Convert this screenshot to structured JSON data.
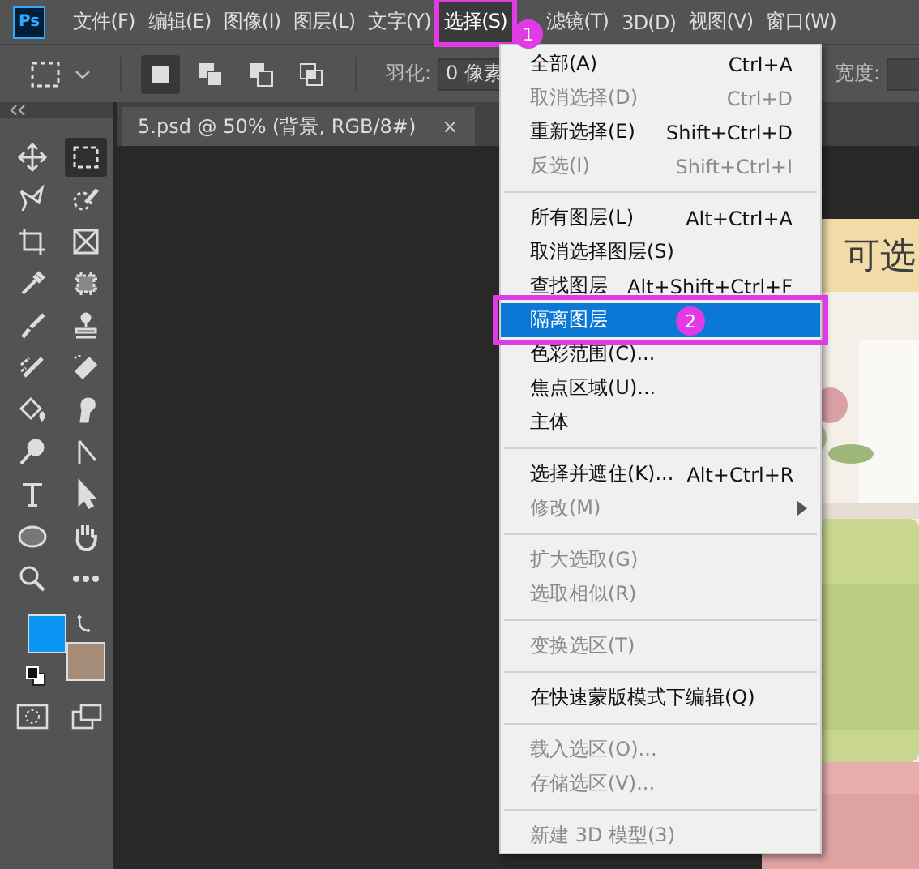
{
  "app": {
    "logo": "Ps"
  },
  "menubar": [
    {
      "label": "文件(F)",
      "selected": false
    },
    {
      "label": "编辑(E)",
      "selected": false
    },
    {
      "label": "图像(I)",
      "selected": false
    },
    {
      "label": "图层(L)",
      "selected": false
    },
    {
      "label": "文字(Y)",
      "selected": false
    },
    {
      "label": "选择(S)",
      "selected": true,
      "callout": "1"
    },
    {
      "label": "滤镜(T)",
      "selected": false
    },
    {
      "label": "3D(D)",
      "selected": false
    },
    {
      "label": "视图(V)",
      "selected": false
    },
    {
      "label": "窗口(W)",
      "selected": false
    }
  ],
  "options_bar": {
    "modes": [
      {
        "kind": "new",
        "selected": true
      },
      {
        "kind": "add",
        "selected": false
      },
      {
        "kind": "subtract",
        "selected": false
      },
      {
        "kind": "intersect",
        "selected": false
      }
    ],
    "feather_label": "羽化:",
    "feather_value": "0 像素",
    "width_label": "宽度:"
  },
  "document_tab": {
    "title": "5.psd @ 50% (背景, RGB/8#)",
    "close": "×"
  },
  "tools": [
    {
      "kind": "move",
      "selected": false
    },
    {
      "kind": "marquee",
      "selected": true
    },
    {
      "kind": "lasso",
      "selected": false
    },
    {
      "kind": "quick-select",
      "selected": false
    },
    {
      "kind": "crop",
      "selected": false
    },
    {
      "kind": "frame",
      "selected": false
    },
    {
      "kind": "eyedropper",
      "selected": false
    },
    {
      "kind": "patch",
      "selected": false
    },
    {
      "kind": "brush",
      "selected": false
    },
    {
      "kind": "stamp",
      "selected": false
    },
    {
      "kind": "history-brush",
      "selected": false
    },
    {
      "kind": "eraser",
      "selected": false
    },
    {
      "kind": "bucket",
      "selected": false
    },
    {
      "kind": "smudge",
      "selected": false
    },
    {
      "kind": "dodge",
      "selected": false
    },
    {
      "kind": "pen",
      "selected": false
    },
    {
      "kind": "type",
      "selected": false
    },
    {
      "kind": "path-select",
      "selected": false
    },
    {
      "kind": "ellipse",
      "selected": false
    },
    {
      "kind": "hand",
      "selected": false
    },
    {
      "kind": "zoom",
      "selected": false
    },
    {
      "kind": "more",
      "selected": false
    }
  ],
  "swatches": [
    {
      "kind": "foreground",
      "color": "#0b96f3"
    },
    {
      "kind": "background",
      "color": "#a48c78"
    }
  ],
  "canvas": {
    "banner_text": "可选"
  },
  "menu": {
    "groups": [
      [
        {
          "label": "全部(A)",
          "shortcut": "Ctrl+A",
          "disabled": false,
          "selected": false,
          "submenu": false
        },
        {
          "label": "取消选择(D)",
          "shortcut": "Ctrl+D",
          "disabled": true,
          "selected": false,
          "submenu": false
        },
        {
          "label": "重新选择(E)",
          "shortcut": "Shift+Ctrl+D",
          "disabled": false,
          "selected": false,
          "submenu": false
        },
        {
          "label": "反选(I)",
          "shortcut": "Shift+Ctrl+I",
          "disabled": true,
          "selected": false,
          "submenu": false
        }
      ],
      [
        {
          "label": "所有图层(L)",
          "shortcut": "Alt+Ctrl+A",
          "disabled": false,
          "selected": false,
          "submenu": false
        },
        {
          "label": "取消选择图层(S)",
          "disabled": false,
          "selected": false,
          "submenu": false
        },
        {
          "label": "查找图层",
          "shortcut": "Alt+Shift+Ctrl+F",
          "disabled": false,
          "selected": false,
          "submenu": false
        },
        {
          "label": "隔离图层",
          "disabled": false,
          "selected": true,
          "submenu": false,
          "callout": "2"
        },
        {
          "label": "色彩范围(C)...",
          "disabled": false,
          "selected": false,
          "submenu": false
        },
        {
          "label": "焦点区域(U)...",
          "disabled": false,
          "selected": false,
          "submenu": false
        },
        {
          "label": "主体",
          "disabled": false,
          "selected": false,
          "submenu": false
        }
      ],
      [
        {
          "label": "选择并遮住(K)...",
          "shortcut": "Alt+Ctrl+R",
          "disabled": false,
          "selected": false,
          "submenu": false
        },
        {
          "label": "修改(M)",
          "disabled": true,
          "selected": false,
          "submenu": true
        }
      ],
      [
        {
          "label": "扩大选取(G)",
          "disabled": true,
          "selected": false,
          "submenu": false
        },
        {
          "label": "选取相似(R)",
          "disabled": true,
          "selected": false,
          "submenu": false
        }
      ],
      [
        {
          "label": "变换选区(T)",
          "disabled": true,
          "selected": false,
          "submenu": false
        }
      ],
      [
        {
          "label": "在快速蒙版模式下编辑(Q)",
          "disabled": false,
          "selected": false,
          "submenu": false
        }
      ],
      [
        {
          "label": "载入选区(O)...",
          "disabled": true,
          "selected": false,
          "submenu": false
        },
        {
          "label": "存储选区(V)...",
          "disabled": true,
          "selected": false,
          "submenu": false
        }
      ],
      [
        {
          "label": "新建 3D 模型(3)",
          "disabled": true,
          "selected": false,
          "submenu": false
        }
      ]
    ]
  }
}
